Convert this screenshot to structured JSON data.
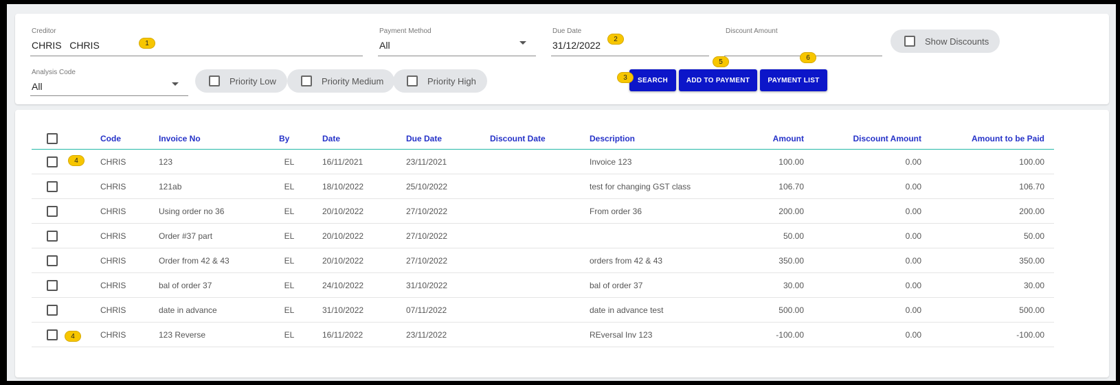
{
  "filters": {
    "creditor": {
      "label": "Creditor",
      "value": "CHRIS   CHRIS"
    },
    "payment_method": {
      "label": "Payment Method",
      "value": "All"
    },
    "due_date": {
      "label": "Due Date",
      "value": "31/12/2022"
    },
    "discount_amount": {
      "label": "Discount Amount",
      "value": ""
    },
    "show_discounts": "Show Discounts",
    "analysis_code": {
      "label": "Analysis Code",
      "value": "All"
    },
    "priority_low": "Priority Low",
    "priority_medium": "Priority Medium",
    "priority_high": "Priority High"
  },
  "buttons": {
    "search": "SEARCH",
    "add_to_payment": "ADD TO PAYMENT",
    "payment_list": "PAYMENT LIST"
  },
  "badges": {
    "b1": "1",
    "b2": "2",
    "b3": "3",
    "b4a": "4",
    "b4b": "4",
    "b5": "5",
    "b6": "6"
  },
  "table": {
    "headers": {
      "code": "Code",
      "invoice_no": "Invoice No",
      "by": "By",
      "date": "Date",
      "due_date": "Due Date",
      "discount_date": "Discount Date",
      "description": "Description",
      "amount": "Amount",
      "discount_amount": "Discount Amount",
      "amount_to_be_paid": "Amount to be Paid"
    },
    "rows": [
      {
        "code": "CHRIS",
        "invoice_no": "123",
        "by": "EL",
        "date": "16/11/2021",
        "due_date": "23/11/2021",
        "discount_date": "",
        "description": "Invoice 123",
        "amount": "100.00",
        "discount_amount": "0.00",
        "amount_to_be_paid": "100.00"
      },
      {
        "code": "CHRIS",
        "invoice_no": "121ab",
        "by": "EL",
        "date": "18/10/2022",
        "due_date": "25/10/2022",
        "discount_date": "",
        "description": "test for changing GST class",
        "amount": "106.70",
        "discount_amount": "0.00",
        "amount_to_be_paid": "106.70"
      },
      {
        "code": "CHRIS",
        "invoice_no": "Using order no 36",
        "by": "EL",
        "date": "20/10/2022",
        "due_date": "27/10/2022",
        "discount_date": "",
        "description": "From order 36",
        "amount": "200.00",
        "discount_amount": "0.00",
        "amount_to_be_paid": "200.00"
      },
      {
        "code": "CHRIS",
        "invoice_no": "Order #37 part",
        "by": "EL",
        "date": "20/10/2022",
        "due_date": "27/10/2022",
        "discount_date": "",
        "description": "",
        "amount": "50.00",
        "discount_amount": "0.00",
        "amount_to_be_paid": "50.00"
      },
      {
        "code": "CHRIS",
        "invoice_no": "Order from 42 & 43",
        "by": "EL",
        "date": "20/10/2022",
        "due_date": "27/10/2022",
        "discount_date": "",
        "description": "orders from 42 & 43",
        "amount": "350.00",
        "discount_amount": "0.00",
        "amount_to_be_paid": "350.00"
      },
      {
        "code": "CHRIS",
        "invoice_no": "bal of order 37",
        "by": "EL",
        "date": "24/10/2022",
        "due_date": "31/10/2022",
        "discount_date": "",
        "description": "bal of order 37",
        "amount": "30.00",
        "discount_amount": "0.00",
        "amount_to_be_paid": "30.00"
      },
      {
        "code": "CHRIS",
        "invoice_no": "date in advance",
        "by": "EL",
        "date": "31/10/2022",
        "due_date": "07/11/2022",
        "discount_date": "",
        "description": "date in advance test",
        "amount": "500.00",
        "discount_amount": "0.00",
        "amount_to_be_paid": "500.00"
      },
      {
        "code": "CHRIS",
        "invoice_no": "123 Reverse",
        "by": "EL",
        "date": "16/11/2022",
        "due_date": "23/11/2022",
        "discount_date": "",
        "description": "REversal Inv 123",
        "amount": "-100.00",
        "discount_amount": "0.00",
        "amount_to_be_paid": "-100.00"
      }
    ]
  }
}
